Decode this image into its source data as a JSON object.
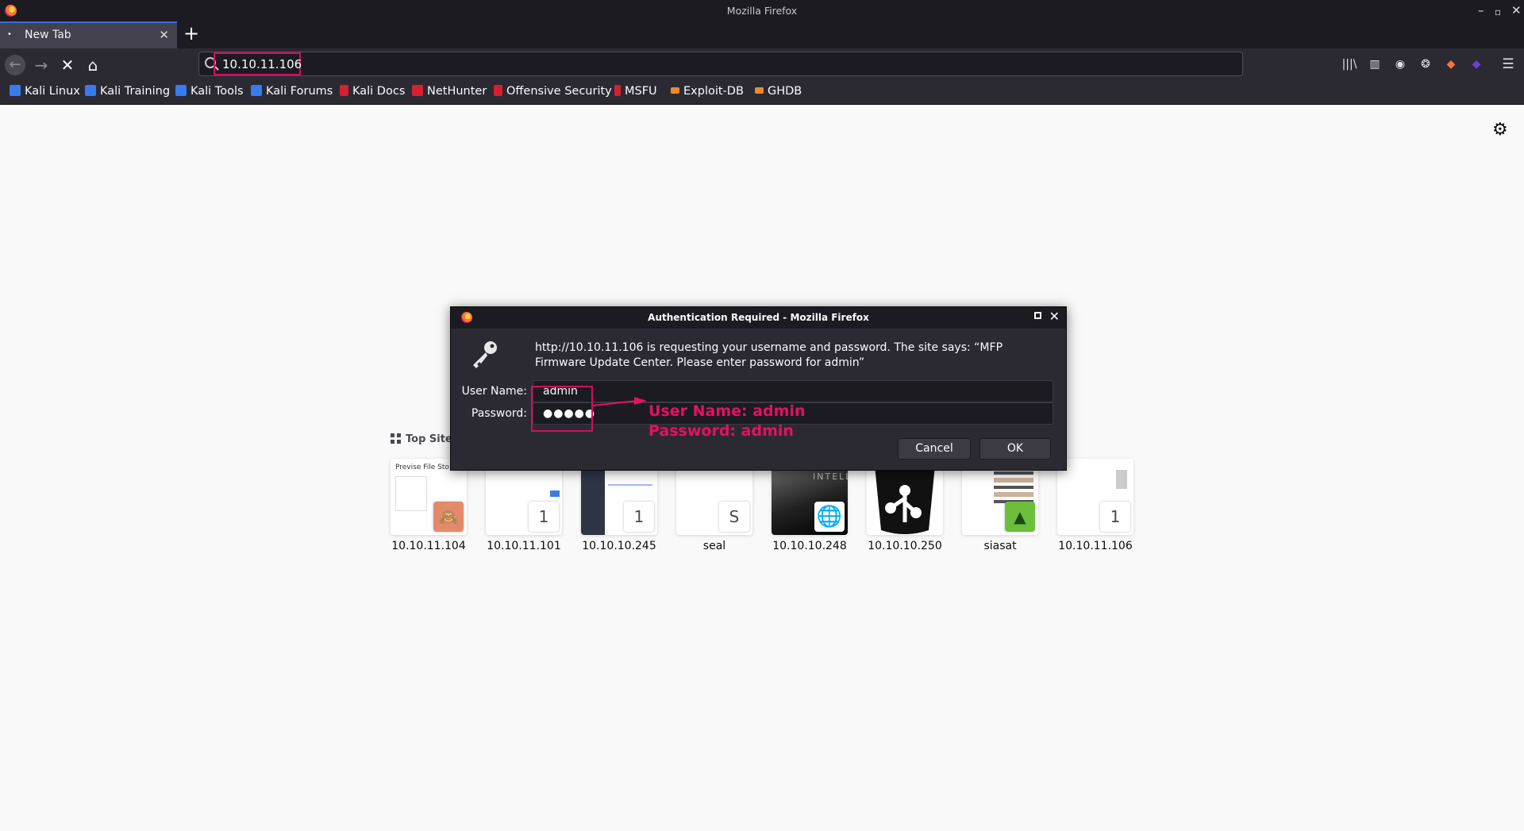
{
  "window": {
    "title": "Mozilla Firefox"
  },
  "tab": {
    "label": "New Tab",
    "dot": "•"
  },
  "toolbar": {
    "url": "10.10.11.106"
  },
  "bookmarks": [
    {
      "label": "Kali Linux",
      "color": "#367bf0"
    },
    {
      "label": "Kali Training",
      "color": "#367bf0"
    },
    {
      "label": "Kali Tools",
      "color": "#367bf0"
    },
    {
      "label": "Kali Forums",
      "color": "#367bf0"
    },
    {
      "label": "Kali Docs",
      "color": "#d6202f"
    },
    {
      "label": "NetHunter",
      "color": "#d6202f"
    },
    {
      "label": "Offensive Security",
      "color": "#d6202f"
    },
    {
      "label": "MSFU",
      "color": "#d6202f"
    },
    {
      "label": "Exploit-DB",
      "color": "#f0892a"
    },
    {
      "label": "GHDB",
      "color": "#f0892a"
    }
  ],
  "newtab": {
    "top_sites_label": "Top Sites",
    "tiles": [
      {
        "label": "10.10.11.104",
        "thumb_text": "Previse File Sto",
        "corner": ""
      },
      {
        "label": "10.10.11.101",
        "corner": "1"
      },
      {
        "label": "10.10.10.245",
        "corner": "1"
      },
      {
        "label": "seal",
        "corner": "S"
      },
      {
        "label": "10.10.10.248",
        "thumb_text": "INTELL",
        "corner": ""
      },
      {
        "label": "10.10.10.250",
        "corner": ""
      },
      {
        "label": "siasat",
        "corner": ""
      },
      {
        "label": "10.10.11.106",
        "corner": "1"
      }
    ]
  },
  "dialog": {
    "title": "Authentication Required - Mozilla Firefox",
    "message": "http://10.10.11.106 is requesting your username and password. The site says: “MFP Firmware Update Center. Please enter password for admin”",
    "username_label": "User Name:",
    "username_value": "admin",
    "password_label": "Password:",
    "password_value": "●●●●●",
    "cancel_label": "Cancel",
    "ok_label": "OK"
  },
  "annotation": {
    "text": "User Name: admin\nPassword: admin",
    "color": "#e3135e"
  }
}
